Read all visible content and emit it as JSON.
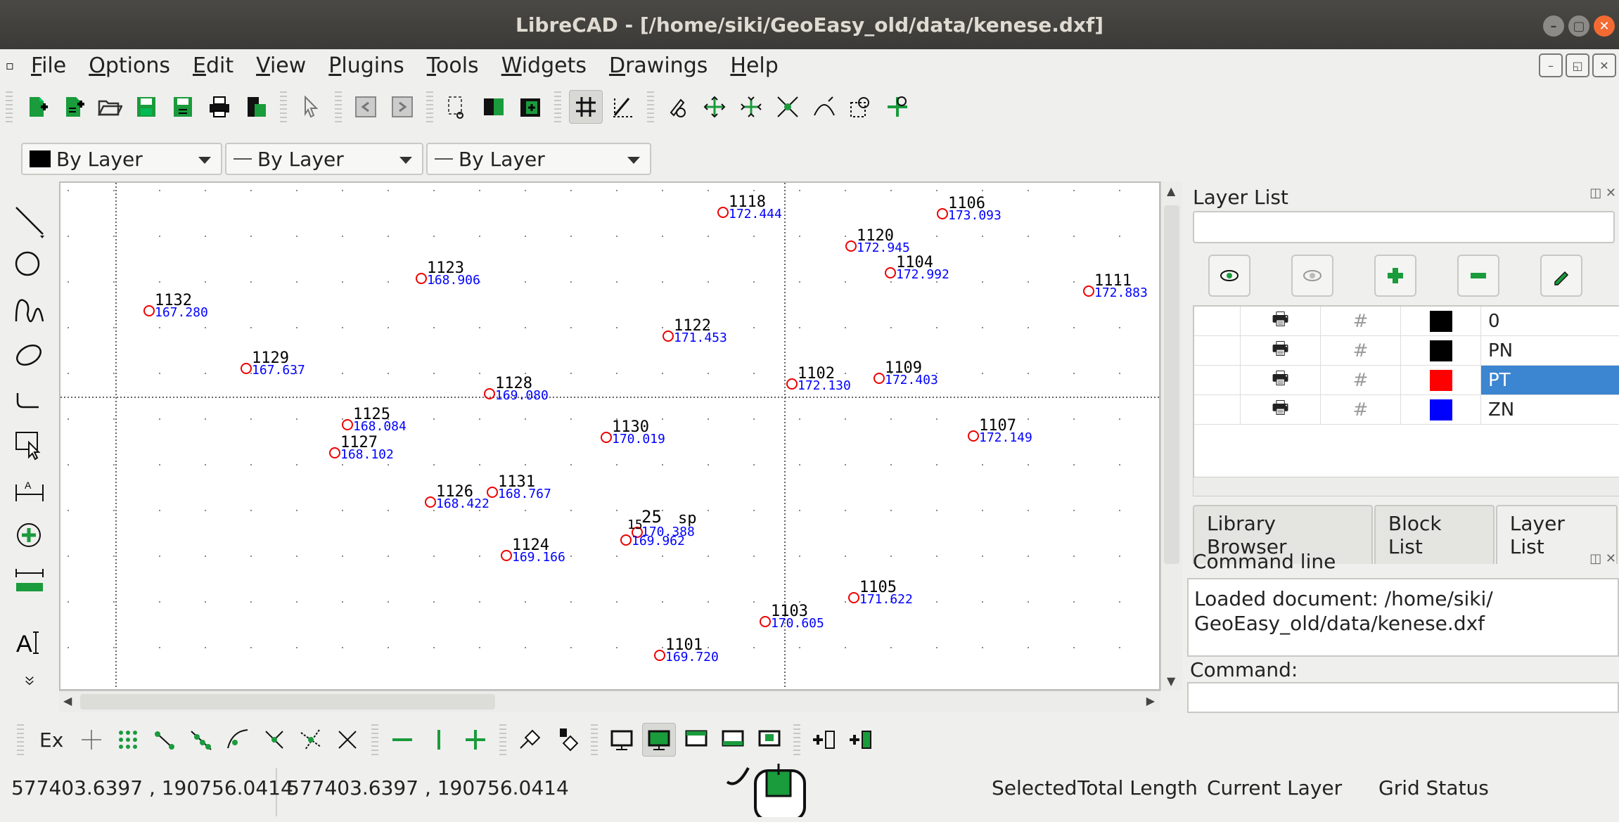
{
  "window": {
    "title": "LibreCAD - [/home/siki/GeoEasy_old/data/kenese.dxf]"
  },
  "menu": [
    "File",
    "Options",
    "Edit",
    "View",
    "Plugins",
    "Tools",
    "Widgets",
    "Drawings",
    "Help"
  ],
  "pen": {
    "color": "By Layer",
    "width": "By Layer",
    "linetype": "By Layer"
  },
  "points": [
    {
      "id": "1118",
      "elev": "172.444"
    },
    {
      "id": "1106",
      "elev": "173.093"
    },
    {
      "id": "1120",
      "elev": "172.945"
    },
    {
      "id": "1104",
      "elev": "172.992"
    },
    {
      "id": "1123",
      "elev": "168.906"
    },
    {
      "id": "1111",
      "elev": "172.883"
    },
    {
      "id": "1132",
      "elev": "167.280"
    },
    {
      "id": "1122",
      "elev": "171.453"
    },
    {
      "id": "1129",
      "elev": "167.637"
    },
    {
      "id": "1102",
      "elev": "172.130"
    },
    {
      "id": "1109",
      "elev": "172.403"
    },
    {
      "id": "1128",
      "elev": "169.080"
    },
    {
      "id": "1125",
      "elev": "168.084"
    },
    {
      "id": "1130",
      "elev": "170.019"
    },
    {
      "id": "1107",
      "elev": "172.149"
    },
    {
      "id": "1127",
      "elev": "168.102"
    },
    {
      "id": "1126",
      "elev": "168.422"
    },
    {
      "id": "1131",
      "elev": "168.767"
    },
    {
      "id": "1124",
      "elev": "169.166"
    },
    {
      "id": "1105",
      "elev": "171.622"
    },
    {
      "id": "1103",
      "elev": "170.605"
    },
    {
      "id": "1101",
      "elev": "169.720"
    }
  ],
  "overlap_labels": {
    "a": "25",
    "b": "sp",
    "c": "15",
    "d": "170.388",
    "e": "169.962"
  },
  "layer_panel": {
    "title": "Layer List",
    "layers": [
      {
        "name": "0",
        "color": "#000000"
      },
      {
        "name": "PN",
        "color": "#000000"
      },
      {
        "name": "PT",
        "color": "#ff0000",
        "selected": true
      },
      {
        "name": "ZN",
        "color": "#0000ff"
      }
    ],
    "tabs": [
      "Library Browser",
      "Block List",
      "Layer List"
    ]
  },
  "command": {
    "title": "Command line",
    "history": "Loaded document: /home/siki/\nGeoEasy_old/data/kenese.dxf",
    "label": "Command:"
  },
  "snap": {
    "exclusive_label": "Ex"
  },
  "status": {
    "abs_coords": "577403.6397 , 190756.0414",
    "rel_coords": "577403.6397 , 190756.0414",
    "selected": "Selected",
    "total_length": "Total Length",
    "current_layer": "Current Layer",
    "grid_status": "Grid Status"
  }
}
